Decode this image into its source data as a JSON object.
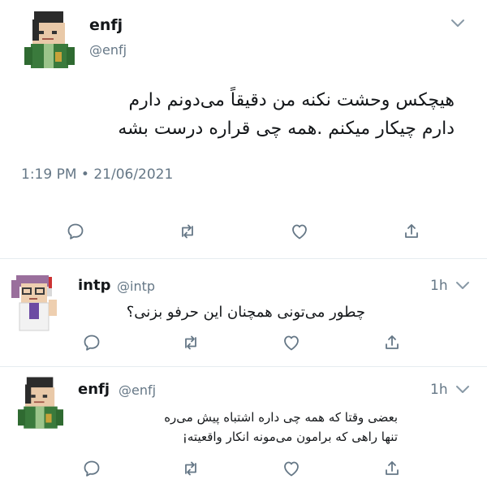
{
  "main_tweet": {
    "name": "enfj",
    "handle": "@enfj",
    "text_line1": "هیچکس وحشت نکنه من دقیقاً می‌دونم دارم",
    "text_line2": "دارم چیکار میکنم .همه چی قراره درست بشه",
    "timestamp": "1:19 PM • 21/06/2021"
  },
  "replies": [
    {
      "name": "intp",
      "handle": "@intp",
      "time": "1h",
      "text_line1": "چطور می‌تونی همچنان این حرفو بزنی؟",
      "text_line2": ""
    },
    {
      "name": "enfj",
      "handle": "@enfj",
      "time": "1h",
      "text_line1": "بعضی وقتا که همه چی داره اشتباه پیش می‌ره",
      "text_line2": "تنها راهی که برامون می‌مونه انکار واقعیته¡"
    }
  ],
  "icons": [
    "reply-icon",
    "retweet-icon",
    "like-icon",
    "share-icon",
    "chevron-down-icon"
  ],
  "colors": {
    "text": "#14171a",
    "muted": "#657786",
    "icon": "#657786",
    "divider": "#e6ecf0"
  }
}
